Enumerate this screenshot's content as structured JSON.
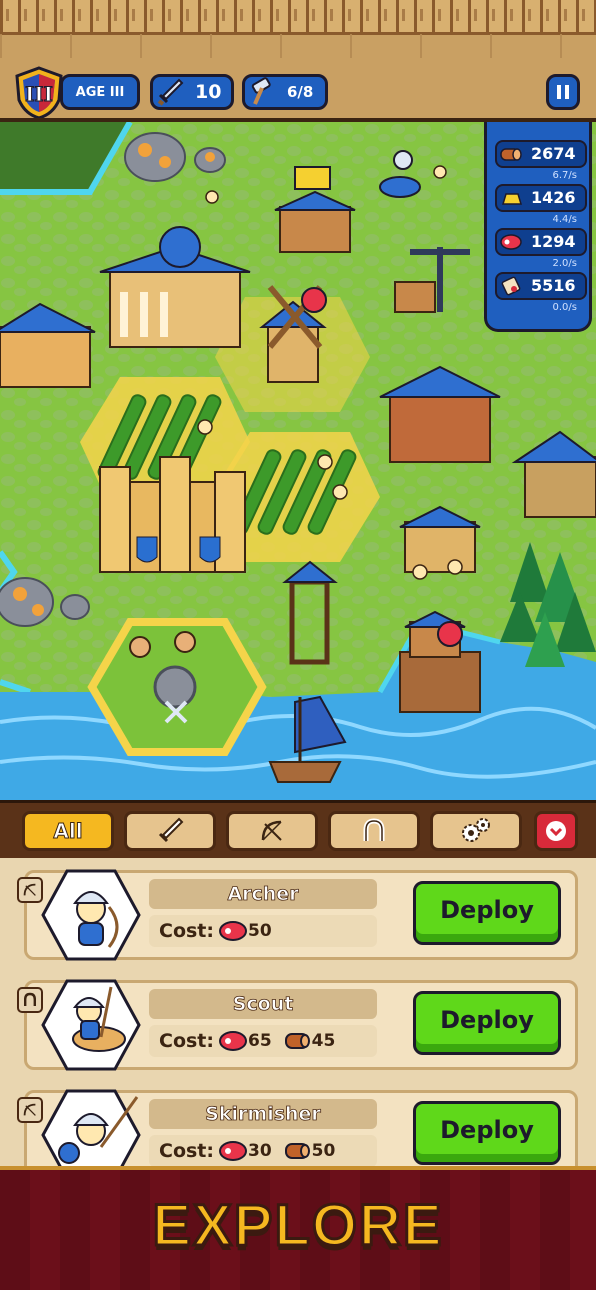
{
  "hud": {
    "age_numeral": "III",
    "age_label": "AGE III",
    "attack_value": "10",
    "builders_value": "6/8",
    "pause_icon": "pause-icon"
  },
  "resources": [
    {
      "icon": "wood-log-icon",
      "value": "2674",
      "rate": "6.7/s"
    },
    {
      "icon": "gold-bar-icon",
      "value": "1426",
      "rate": "4.4/s"
    },
    {
      "icon": "meat-icon",
      "value": "1294",
      "rate": "2.0/s"
    },
    {
      "icon": "scroll-icon",
      "value": "5516",
      "rate": "0.0/s"
    }
  ],
  "filters": {
    "all_label": "All",
    "tabs": [
      "sword-icon",
      "bow-icon",
      "horseshoe-icon",
      "gears-icon"
    ],
    "collapse_icon": "chevron-down-icon"
  },
  "units": [
    {
      "name": "Archer",
      "type_icon": "bow-icon",
      "cost_label": "Cost:",
      "costs": [
        {
          "icon": "meat-icon",
          "amount": "50"
        }
      ],
      "deploy_label": "Deploy"
    },
    {
      "name": "Scout",
      "type_icon": "horseshoe-icon",
      "cost_label": "Cost:",
      "costs": [
        {
          "icon": "meat-icon",
          "amount": "65"
        },
        {
          "icon": "wood-log-icon",
          "amount": "45"
        }
      ],
      "deploy_label": "Deploy"
    },
    {
      "name": "Skirmisher",
      "type_icon": "bow-icon",
      "cost_label": "Cost:",
      "costs": [
        {
          "icon": "meat-icon",
          "amount": "30"
        },
        {
          "icon": "wood-log-icon",
          "amount": "50"
        }
      ],
      "deploy_label": "Deploy"
    }
  ],
  "banner": {
    "title": "EXPLORE"
  },
  "colors": {
    "hud_blue": "#1f5fbf",
    "deploy_green": "#5fd81a",
    "tab_active": "#f5b820",
    "banner_red": "#6b0f1a",
    "grass": "#7cc23a",
    "water": "#3fa9e6"
  }
}
